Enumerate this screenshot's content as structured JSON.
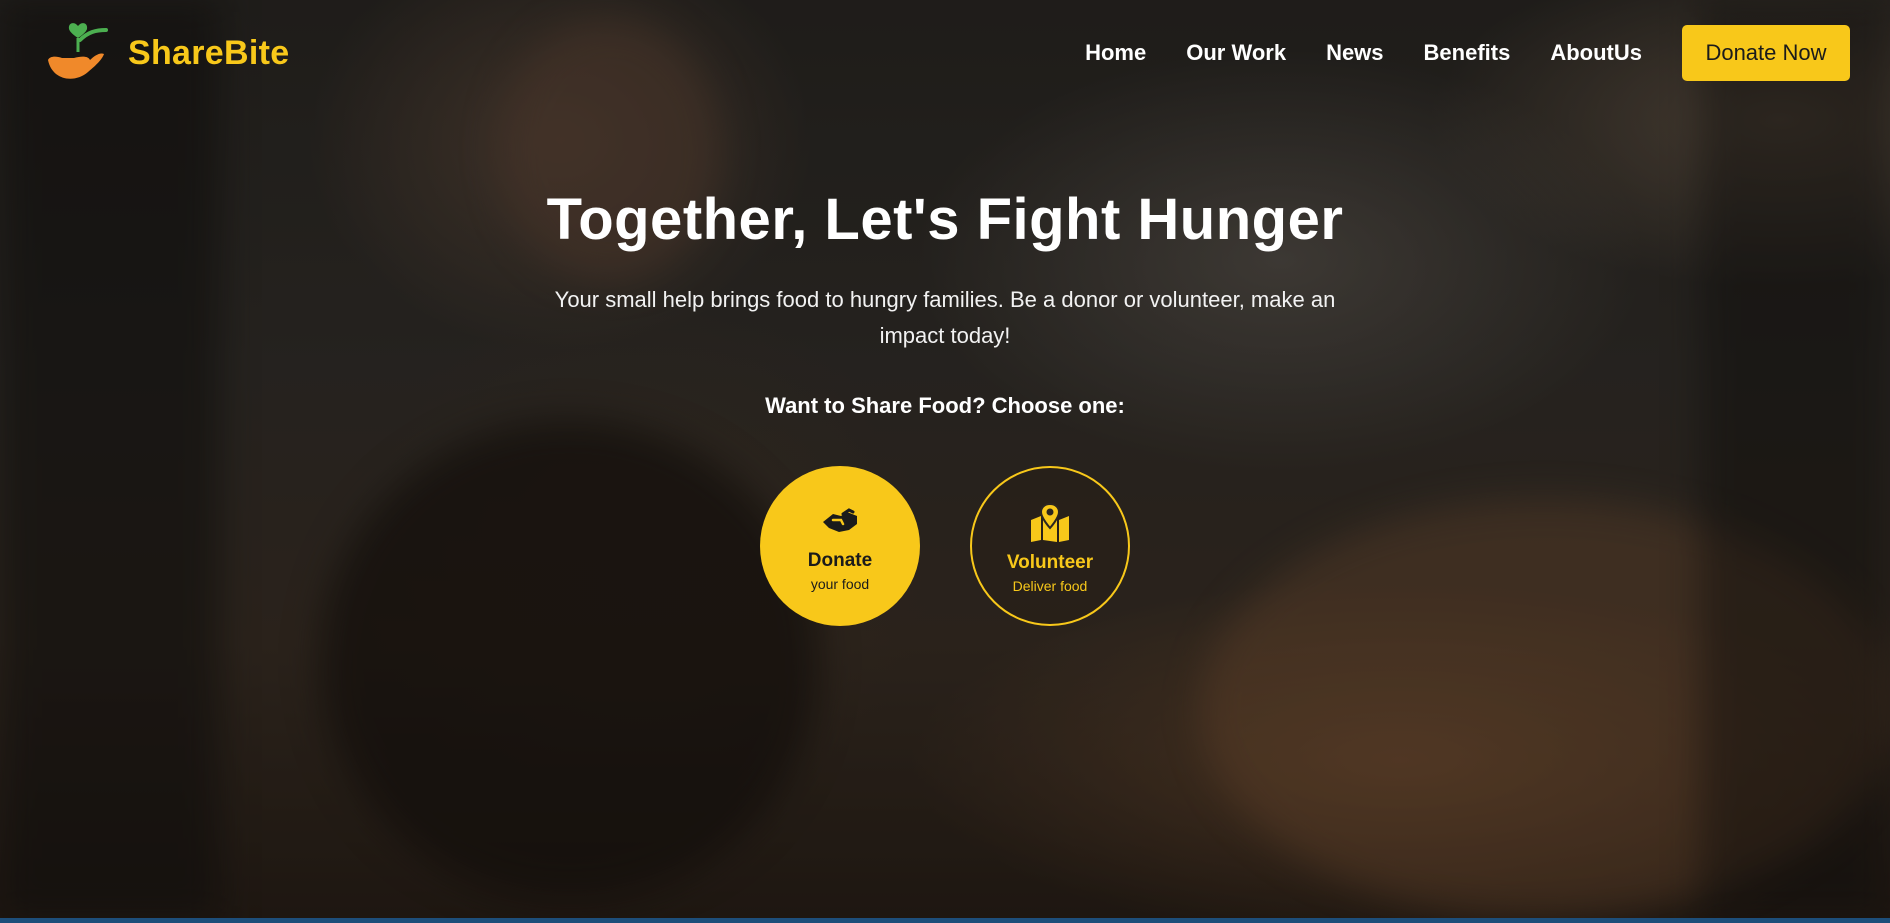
{
  "brand": {
    "name": "ShareBite",
    "logo_icon": "hand-holding-heart-icon"
  },
  "nav": {
    "items": [
      {
        "label": "Home"
      },
      {
        "label": "Our Work"
      },
      {
        "label": "News"
      },
      {
        "label": "Benefits"
      },
      {
        "label": "AboutUs"
      }
    ],
    "cta_label": "Donate Now"
  },
  "hero": {
    "headline": "Together, Let's Fight Hunger",
    "subtitle": "Your small help brings food to hungry families. Be a donor or volunteer, make an impact today!",
    "choose_prompt": "Want to Share Food? Choose one:",
    "options": [
      {
        "title": "Donate",
        "subtitle": "your food",
        "icon": "handshake-icon"
      },
      {
        "title": "Volunteer",
        "subtitle": "Deliver food",
        "icon": "map-location-icon"
      }
    ]
  },
  "colors": {
    "accent": "#f8c81a",
    "text": "#ffffff",
    "logo_orange": "#f0892a",
    "logo_green": "#4caf50"
  }
}
